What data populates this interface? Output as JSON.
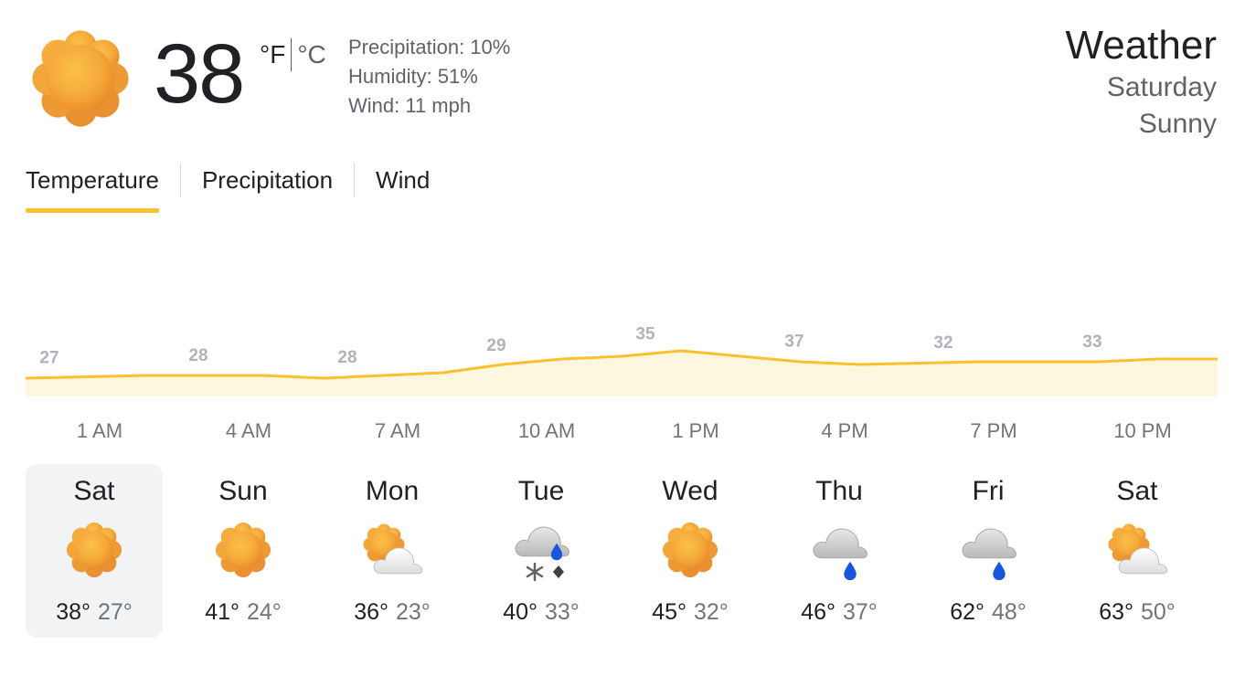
{
  "current": {
    "temperature": "38",
    "icon": "sunny-icon",
    "unit_f": "°F",
    "unit_c": "°C",
    "precipitation": "Precipitation: 10%",
    "humidity": "Humidity: 51%",
    "wind": "Wind: 11 mph"
  },
  "header": {
    "title": "Weather",
    "day": "Saturday",
    "condition": "Sunny"
  },
  "tabs": [
    {
      "label": "Temperature",
      "active": true
    },
    {
      "label": "Precipitation",
      "active": false
    },
    {
      "label": "Wind",
      "active": false
    }
  ],
  "colors": {
    "accent": "#fbc02d",
    "chart_fill": "#fef7e0",
    "chart_label": "#b0b3b8",
    "rain_drop": "#1a56db"
  },
  "chart_data": {
    "type": "area",
    "x": [
      "1 AM",
      "4 AM",
      "7 AM",
      "10 AM",
      "1 PM",
      "4 PM",
      "7 PM",
      "10 PM"
    ],
    "labels": [
      27,
      28,
      28,
      29,
      35,
      37,
      32,
      33
    ],
    "curve": [
      27,
      27.5,
      28,
      28,
      28,
      27,
      28,
      29,
      32,
      34,
      35,
      37,
      35,
      33,
      32,
      32.5,
      33,
      33,
      33,
      34,
      34
    ],
    "grid": false,
    "legend": "none"
  },
  "hours": [
    "1 AM",
    "4 AM",
    "7 AM",
    "10 AM",
    "1 PM",
    "4 PM",
    "7 PM",
    "10 PM"
  ],
  "days": [
    {
      "name": "Sat",
      "icon": "sunny-icon",
      "hi": "38°",
      "lo": "27°",
      "selected": true
    },
    {
      "name": "Sun",
      "icon": "sunny-icon",
      "hi": "41°",
      "lo": "24°",
      "selected": false
    },
    {
      "name": "Mon",
      "icon": "partly-cloudy-icon",
      "hi": "36°",
      "lo": "23°",
      "selected": false
    },
    {
      "name": "Tue",
      "icon": "wintry-mix-icon",
      "hi": "40°",
      "lo": "33°",
      "selected": false
    },
    {
      "name": "Wed",
      "icon": "sunny-icon",
      "hi": "45°",
      "lo": "32°",
      "selected": false
    },
    {
      "name": "Thu",
      "icon": "rain-icon",
      "hi": "46°",
      "lo": "37°",
      "selected": false
    },
    {
      "name": "Fri",
      "icon": "rain-icon",
      "hi": "62°",
      "lo": "48°",
      "selected": false
    },
    {
      "name": "Sat",
      "icon": "partly-cloudy-icon",
      "hi": "63°",
      "lo": "50°",
      "selected": false
    }
  ]
}
